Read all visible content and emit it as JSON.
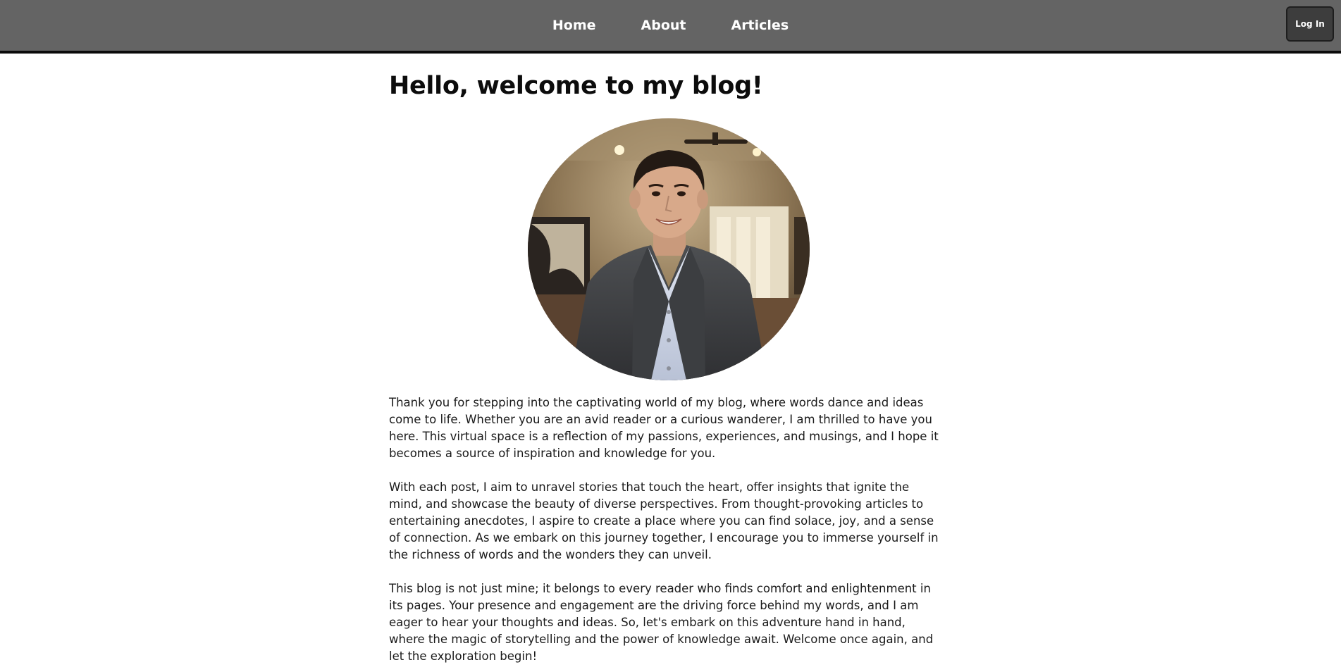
{
  "nav": {
    "links": [
      {
        "label": "Home"
      },
      {
        "label": "About"
      },
      {
        "label": "Articles"
      }
    ],
    "login_label": "Log In"
  },
  "page": {
    "title": "Hello, welcome to my blog!",
    "paragraphs": [
      "Thank you for stepping into the captivating world of my blog, where words dance and ideas come to life. Whether you are an avid reader or a curious wanderer, I am thrilled to have you here. This virtual space is a reflection of my passions, experiences, and musings, and I hope it becomes a source of inspiration and knowledge for you.",
      "With each post, I aim to unravel stories that touch the heart, offer insights that ignite the mind, and showcase the beauty of diverse perspectives. From thought-provoking articles to entertaining anecdotes, I aspire to create a place where you can find solace, joy, and a sense of connection. As we embark on this journey together, I encourage you to immerse yourself in the richness of words and the wonders they can unveil.",
      "This blog is not just mine; it belongs to every reader who finds comfort and enlightenment in its pages. Your presence and engagement are the driving force behind my words, and I am eager to hear your thoughts and ideas. So, let's embark on this adventure hand in hand, where the magic of storytelling and the power of knowledge await. Welcome once again, and let the exploration begin!"
    ]
  },
  "colors": {
    "navbar": "#646464",
    "navbar_border": "#0b0b0b",
    "login_bg": "#3d3d3d"
  }
}
